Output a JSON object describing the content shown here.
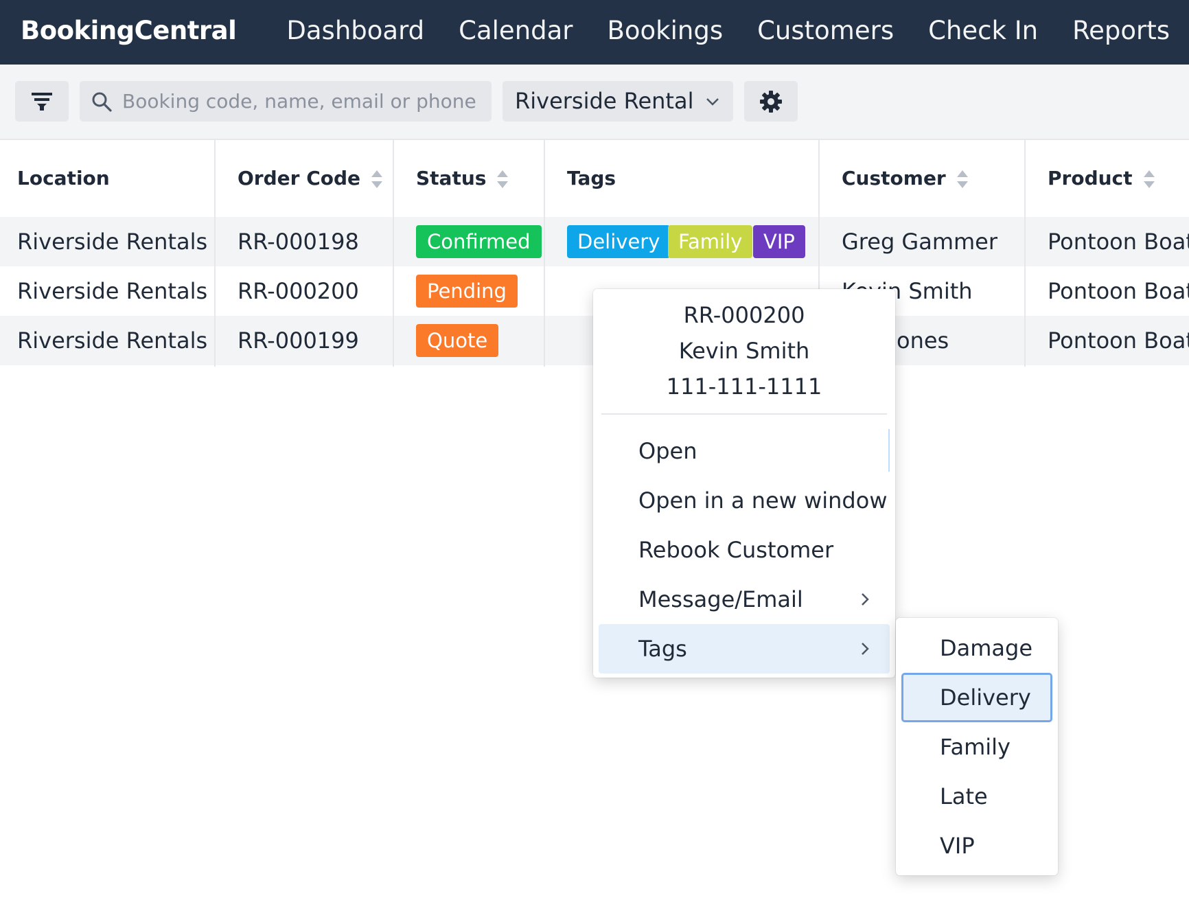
{
  "app": {
    "brand": "BookingCentral"
  },
  "nav": [
    {
      "label": "Dashboard"
    },
    {
      "label": "Calendar"
    },
    {
      "label": "Bookings"
    },
    {
      "label": "Customers"
    },
    {
      "label": "Check In"
    },
    {
      "label": "Reports"
    }
  ],
  "toolbar": {
    "search_placeholder": "Booking code, name, email or phone",
    "location_value": "Riverside Rentals"
  },
  "table": {
    "columns": [
      "Location",
      "Order Code",
      "Status",
      "Tags",
      "Customer",
      "Product"
    ],
    "rows": [
      {
        "location": "Riverside Rentals",
        "code": "RR-000198",
        "status": "Confirmed",
        "status_color": "#16c25a",
        "tags": [
          {
            "label": "Delivery",
            "color": "#0ea5e9"
          },
          {
            "label": "Family",
            "color": "#c7d744"
          },
          {
            "label": "VIP",
            "color": "#6d3bbf"
          }
        ],
        "customer": "Greg Gammer",
        "product": "Pontoon Boat"
      },
      {
        "location": "Riverside Rentals",
        "code": "RR-000200",
        "status": "Pending",
        "status_color": "#fb7a2a",
        "tags": [],
        "customer": "Kevin Smith",
        "product": "Pontoon Boat"
      },
      {
        "location": "Riverside Rentals",
        "code": "RR-000199",
        "status": "Quote",
        "status_color": "#fb7a2a",
        "tags": [],
        "customer": "ones",
        "product": "Pontoon Boat"
      }
    ]
  },
  "context_menu": {
    "code": "RR-000200",
    "name": "Kevin Smith",
    "phone": "111-111-1111",
    "items": [
      "Open",
      "Open in a new window",
      "Rebook Customer",
      "Message/Email",
      "Tags"
    ]
  },
  "tags_submenu": {
    "items": [
      "Damage",
      "Delivery",
      "Family",
      "Late",
      "VIP"
    ]
  }
}
